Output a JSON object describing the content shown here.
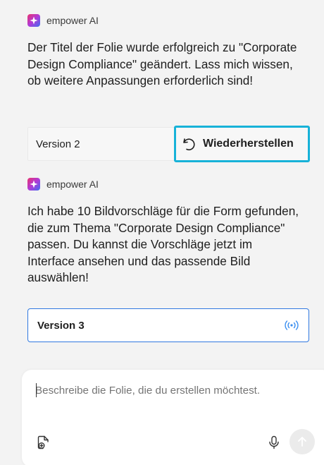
{
  "messages": [
    {
      "sender": "empower AI",
      "text": "Der Titel der Folie wurde erfolgreich zu \"Corporate Design Compliance\" geändert. Lass mich wissen, ob weitere Anpassungen erforderlich sind!",
      "version_label": "Version 2",
      "action_label": "Wiederherstellen"
    },
    {
      "sender": "empower AI",
      "text": "Ich habe 10 Bildvorschläge für die Form gefunden, die zum Thema \"Corporate Design Compliance\" passen. Du kannst die Vorschläge jetzt im Interface ansehen und das passende Bild auswählen!",
      "version_label": "Version 3",
      "status_icon": "broadcast-icon"
    }
  ],
  "composer": {
    "placeholder": "Beschreibe die Folie, die du erstellen möchtest.",
    "value": "",
    "attach_icon": "add-document-icon",
    "mic_icon": "microphone-icon",
    "send_icon": "arrow-up-icon"
  },
  "colors": {
    "background": "#f3f3f3",
    "focus_ring": "#17b2d8",
    "active_border": "#2f78e0",
    "accent_icon": "#3b8ff0"
  }
}
